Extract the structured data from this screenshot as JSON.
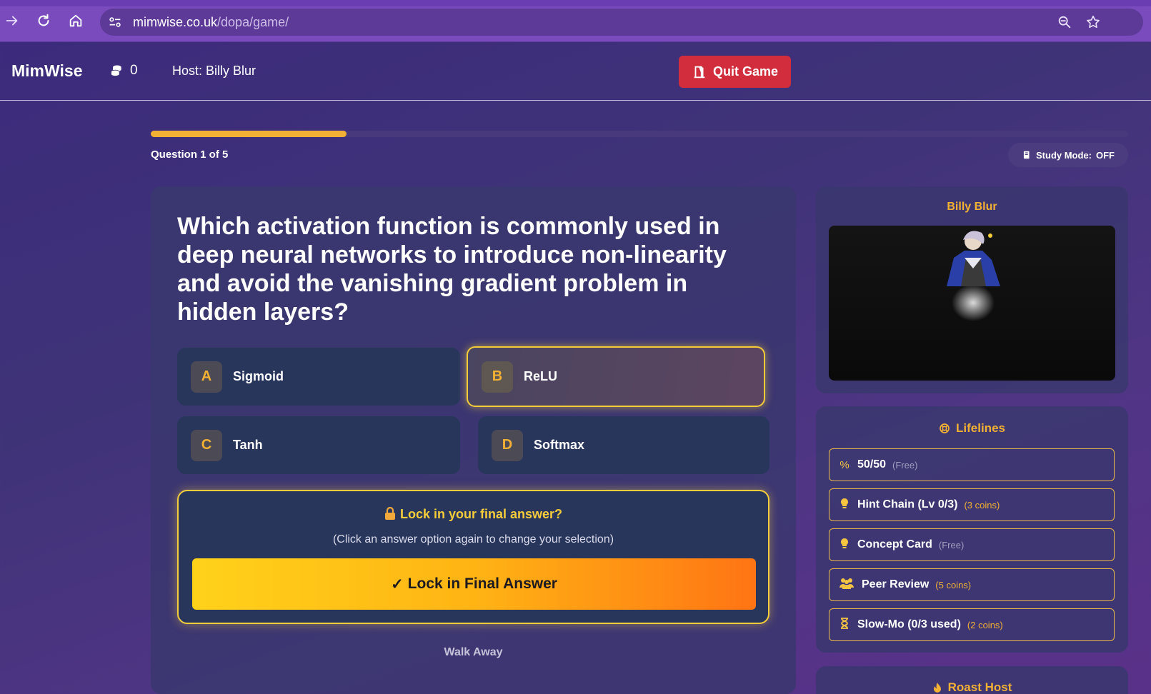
{
  "browser": {
    "url_domain": "mimwise.co.uk",
    "url_path": "/dopa/game/"
  },
  "header": {
    "logo": "MimWise",
    "coins": "0",
    "host_label": "Host: Billy Blur",
    "quit_label": "Quit Game"
  },
  "progress": {
    "fraction": 0.2,
    "counter": "Question 1 of 5"
  },
  "study_mode": {
    "label": "Study Mode:",
    "value": "OFF"
  },
  "question": {
    "text": "Which activation function is commonly used in deep neural networks to introduce non-linearity and avoid the vanishing gradient problem in hidden layers?",
    "options": [
      {
        "letter": "A",
        "label": "Sigmoid",
        "selected": false
      },
      {
        "letter": "B",
        "label": "ReLU",
        "selected": true
      },
      {
        "letter": "C",
        "label": "Tanh",
        "selected": false
      },
      {
        "letter": "D",
        "label": "Softmax",
        "selected": false
      }
    ]
  },
  "lock": {
    "title": "Lock in your final answer?",
    "subtitle": "(Click an answer option again to change your selection)",
    "button": "Lock in Final Answer"
  },
  "walk_away": "Walk Away",
  "host_panel": {
    "name": "Billy Blur"
  },
  "lifelines": {
    "title": "Lifelines",
    "items": [
      {
        "icon": "percent-icon",
        "name": "50/50",
        "cost": "(Free)",
        "paid": false
      },
      {
        "icon": "lightbulb-icon",
        "name": "Hint Chain (Lv 0/3)",
        "cost": "(3 coins)",
        "paid": true
      },
      {
        "icon": "lightbulb-icon",
        "name": "Concept Card",
        "cost": "(Free)",
        "paid": false
      },
      {
        "icon": "users-icon",
        "name": "Peer Review",
        "cost": "(5 coins)",
        "paid": true
      },
      {
        "icon": "hourglass-icon",
        "name": "Slow-Mo (0/3 used)",
        "cost": "(2 coins)",
        "paid": true
      }
    ]
  },
  "roast": {
    "title": "Roast Host"
  },
  "colors": {
    "accent": "#f2b134",
    "selected_border": "#f5cd3b",
    "quit": "#d12d3d"
  }
}
